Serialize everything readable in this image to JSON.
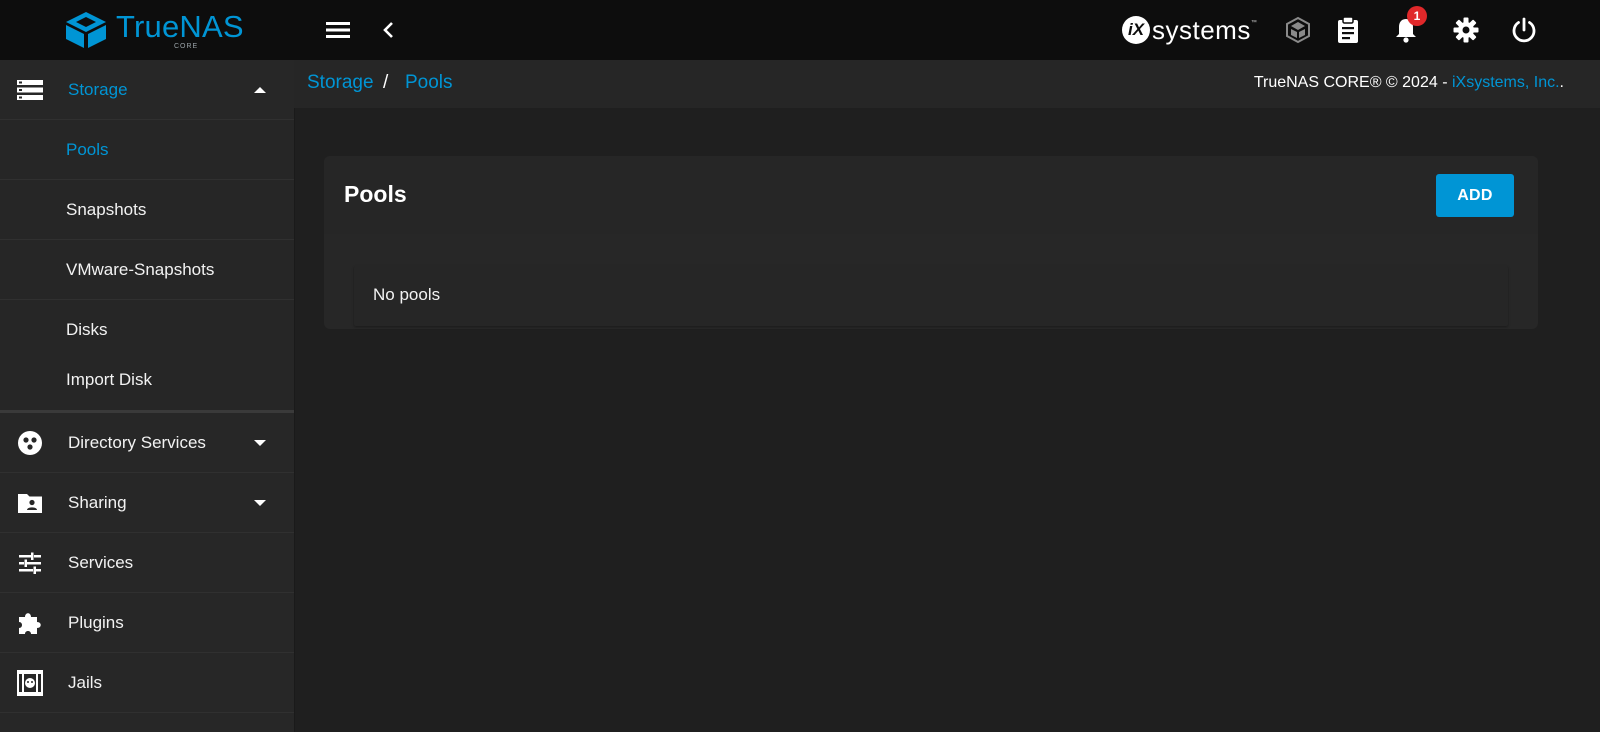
{
  "app": {
    "brand_name": "TrueNAS",
    "brand_edition": "CORE",
    "vendor_logo_letter": "iX",
    "vendor_logo_text": "systems",
    "vendor_logo_tm": "™"
  },
  "topbar": {
    "menu_icon": "menu-icon",
    "back_icon": "chevron-left-icon",
    "icons": [
      "truecommand-icon",
      "clipboard-icon",
      "bell-icon",
      "gear-icon",
      "power-icon"
    ],
    "notification_count": "1"
  },
  "sidebar": {
    "storage": {
      "label": "Storage",
      "icon": "storage-icon",
      "expanded": true
    },
    "storage_children": [
      {
        "label": "Pools",
        "active": true
      },
      {
        "label": "Snapshots"
      },
      {
        "label": "VMware-Snapshots"
      },
      {
        "label": "Disks"
      },
      {
        "label": "Import Disk"
      }
    ],
    "items": [
      {
        "label": "Directory Services",
        "icon": "directory-services-icon"
      },
      {
        "label": "Sharing",
        "icon": "folder-shared-icon"
      },
      {
        "label": "Services",
        "icon": "tune-icon"
      },
      {
        "label": "Plugins",
        "icon": "puzzle-icon"
      },
      {
        "label": "Jails",
        "icon": "jail-icon"
      }
    ]
  },
  "breadcrumb": {
    "items": [
      "Storage",
      "Pools"
    ],
    "separator": "/"
  },
  "footer_copyright": {
    "text": "TrueNAS CORE® © 2024 - ",
    "link": "iXsystems, Inc.",
    "trailing": "."
  },
  "pools_card": {
    "title": "Pools",
    "add_label": "ADD",
    "empty_message": "No pools"
  },
  "colors": {
    "accent": "#0095d5",
    "badge": "#e0282a",
    "topbar_bg": "#0d0d0d",
    "sidebar_bg": "#272727",
    "content_bg": "#1f1f1f"
  }
}
